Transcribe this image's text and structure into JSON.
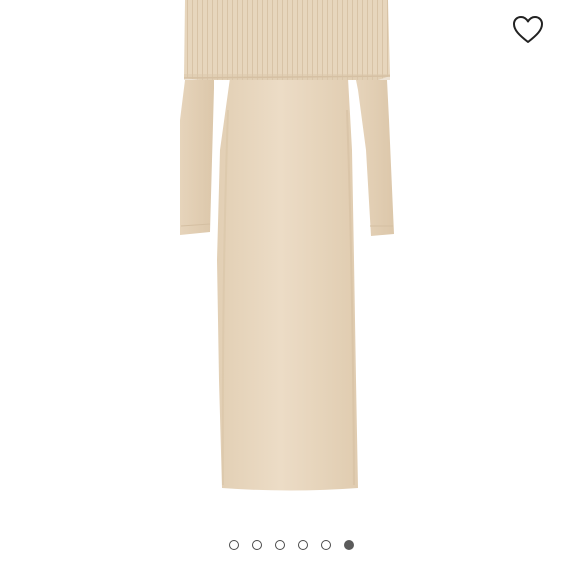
{
  "product": {
    "image_icon": "knit-midi-dress-photo",
    "image_color": "#e9d9c2"
  },
  "favorite": {
    "icon": "heart-outline-icon",
    "selected": false
  },
  "carousel": {
    "slide_count": 6,
    "active_index": 5
  },
  "colors": {
    "background": "#ffffff",
    "dot_border": "#4a4a4a",
    "dot_active": "#5b5b5b"
  }
}
